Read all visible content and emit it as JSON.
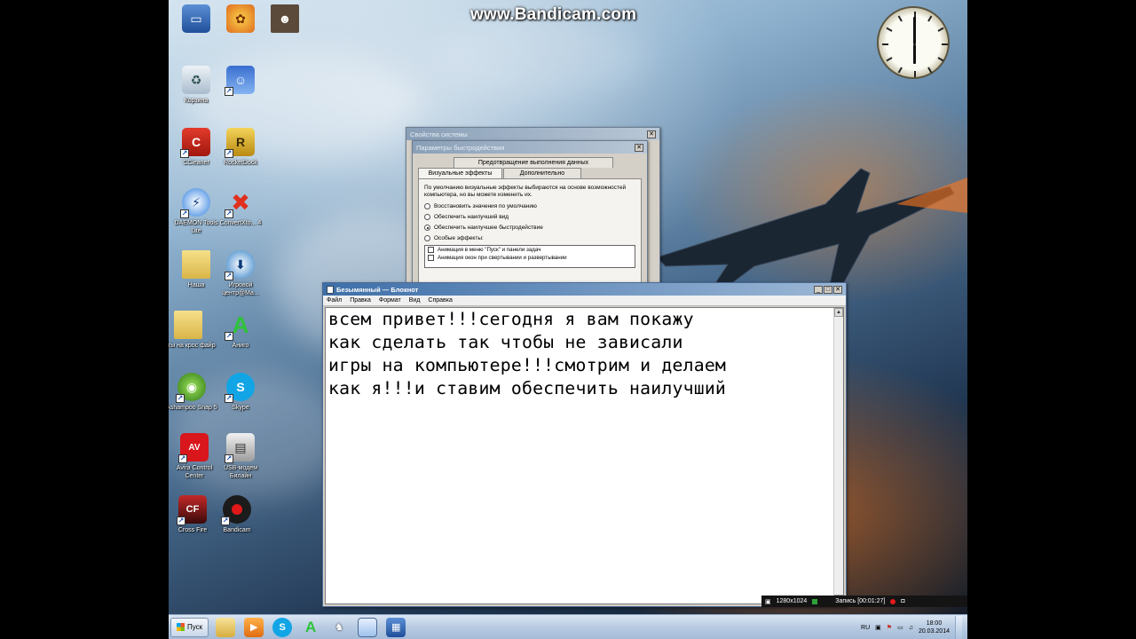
{
  "watermark": "www.Bandicam.com",
  "desktop_icons": [
    {
      "label": "",
      "icon": "computer-icon"
    },
    {
      "label": "",
      "icon": "flower-icon"
    },
    {
      "label": "",
      "icon": "game-avatar-icon"
    },
    {
      "label": "Корзина",
      "icon": "recycle-bin-icon"
    },
    {
      "label": "",
      "icon": "anime-avatar-icon"
    },
    {
      "label": "CCleaner",
      "icon": "ccleaner-icon"
    },
    {
      "label": "RocketDock",
      "icon": "rocketdock-icon"
    },
    {
      "label": "DAEMON Tools Lite",
      "icon": "daemon-tools-icon"
    },
    {
      "label": "ConvertXto... 4",
      "icon": "convertx-icon"
    },
    {
      "label": "Наша",
      "icon": "folder-icon"
    },
    {
      "label": "Игровой центр@Ма...",
      "icon": "game-center-icon"
    },
    {
      "label": "читы на крос файр",
      "icon": "folder-icon"
    },
    {
      "label": "Аниго",
      "icon": "anigo-icon"
    },
    {
      "label": "Ashampoo Snap 5",
      "icon": "ashampoo-icon"
    },
    {
      "label": "Skype",
      "icon": "skype-icon"
    },
    {
      "label": "Avira Control Center",
      "icon": "avira-icon"
    },
    {
      "label": "USB-модем Билайн",
      "icon": "usb-modem-icon"
    },
    {
      "label": "Cross Fire",
      "icon": "crossfire-icon"
    },
    {
      "label": "Bandicam",
      "icon": "bandicam-icon"
    }
  ],
  "system_properties": {
    "title": "Свойства системы"
  },
  "performance_options": {
    "title": "Параметры быстродействия",
    "tabs": [
      "Предотвращение выполнения данных",
      "Визуальные эффекты",
      "Дополнительно"
    ],
    "description": "По умолчанию визуальные эффекты выбираются на основе возможностей компьютера, но вы можете изменить их.",
    "radios": [
      {
        "label": "Восстановить значения по умолчанию",
        "checked": false
      },
      {
        "label": "Обеспечить наилучший вид",
        "checked": false
      },
      {
        "label": "Обеспечить наилучшее быстродействие",
        "checked": true
      },
      {
        "label": "Особые эффекты:",
        "checked": false
      }
    ],
    "effects": [
      "Анимация в меню \"Пуск\" и панели задач",
      "Анимация окон при свертывании и развертывании"
    ]
  },
  "notepad": {
    "title": "Безымянный — Блокнот",
    "menu": [
      "Файл",
      "Правка",
      "Формат",
      "Вид",
      "Справка"
    ],
    "text": "всем привет!!!сегодня я вам покажу\nкак сделать так чтобы не зависали\nигры на компьютере!!!смотрим и делаем\nкак я!!!и ставим обеспечить наилучший"
  },
  "bandicam_bar": {
    "resolution": "1280x1024",
    "record": "Запись [00:01:27]"
  },
  "taskbar": {
    "start_label": "Пуск",
    "pinned": [
      "folder-icon",
      "media-player-icon",
      "skype-icon",
      "anigo-icon",
      "cat-icon",
      "notepad-icon",
      "system-icon"
    ],
    "language": "RU",
    "time": "18:00",
    "date": "20.03.2014"
  }
}
